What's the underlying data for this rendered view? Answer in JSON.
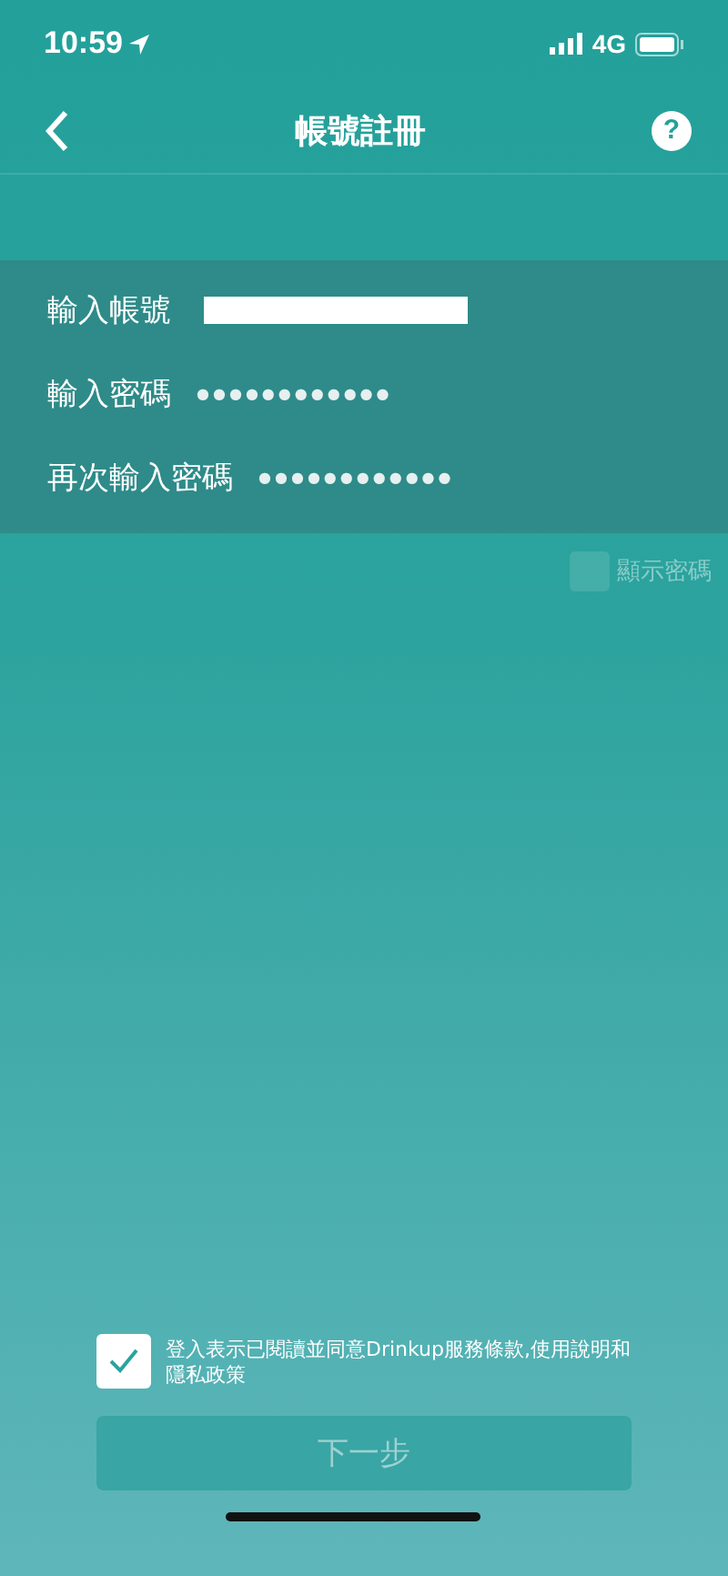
{
  "status_bar": {
    "time": "10:59",
    "network": "4G"
  },
  "nav": {
    "title": "帳號註冊",
    "help": "?"
  },
  "form": [
    {
      "kind": "redacted",
      "label": "輸入帳號"
    },
    {
      "kind": "secret",
      "label": "輸入密碼",
      "value": "●●●●●●●●●●●●"
    },
    {
      "kind": "secret",
      "label": "再次輸入密碼",
      "value": "●●●●●●●●●●●●"
    }
  ],
  "show_password": {
    "label": "顯示密碼",
    "checked": false
  },
  "terms": {
    "text": "登入表示已閱讀並同意Drinkup服務條款,使用說明和隱私政策",
    "checked": true
  },
  "next_button": {
    "label": "下一步",
    "disabled": true
  }
}
